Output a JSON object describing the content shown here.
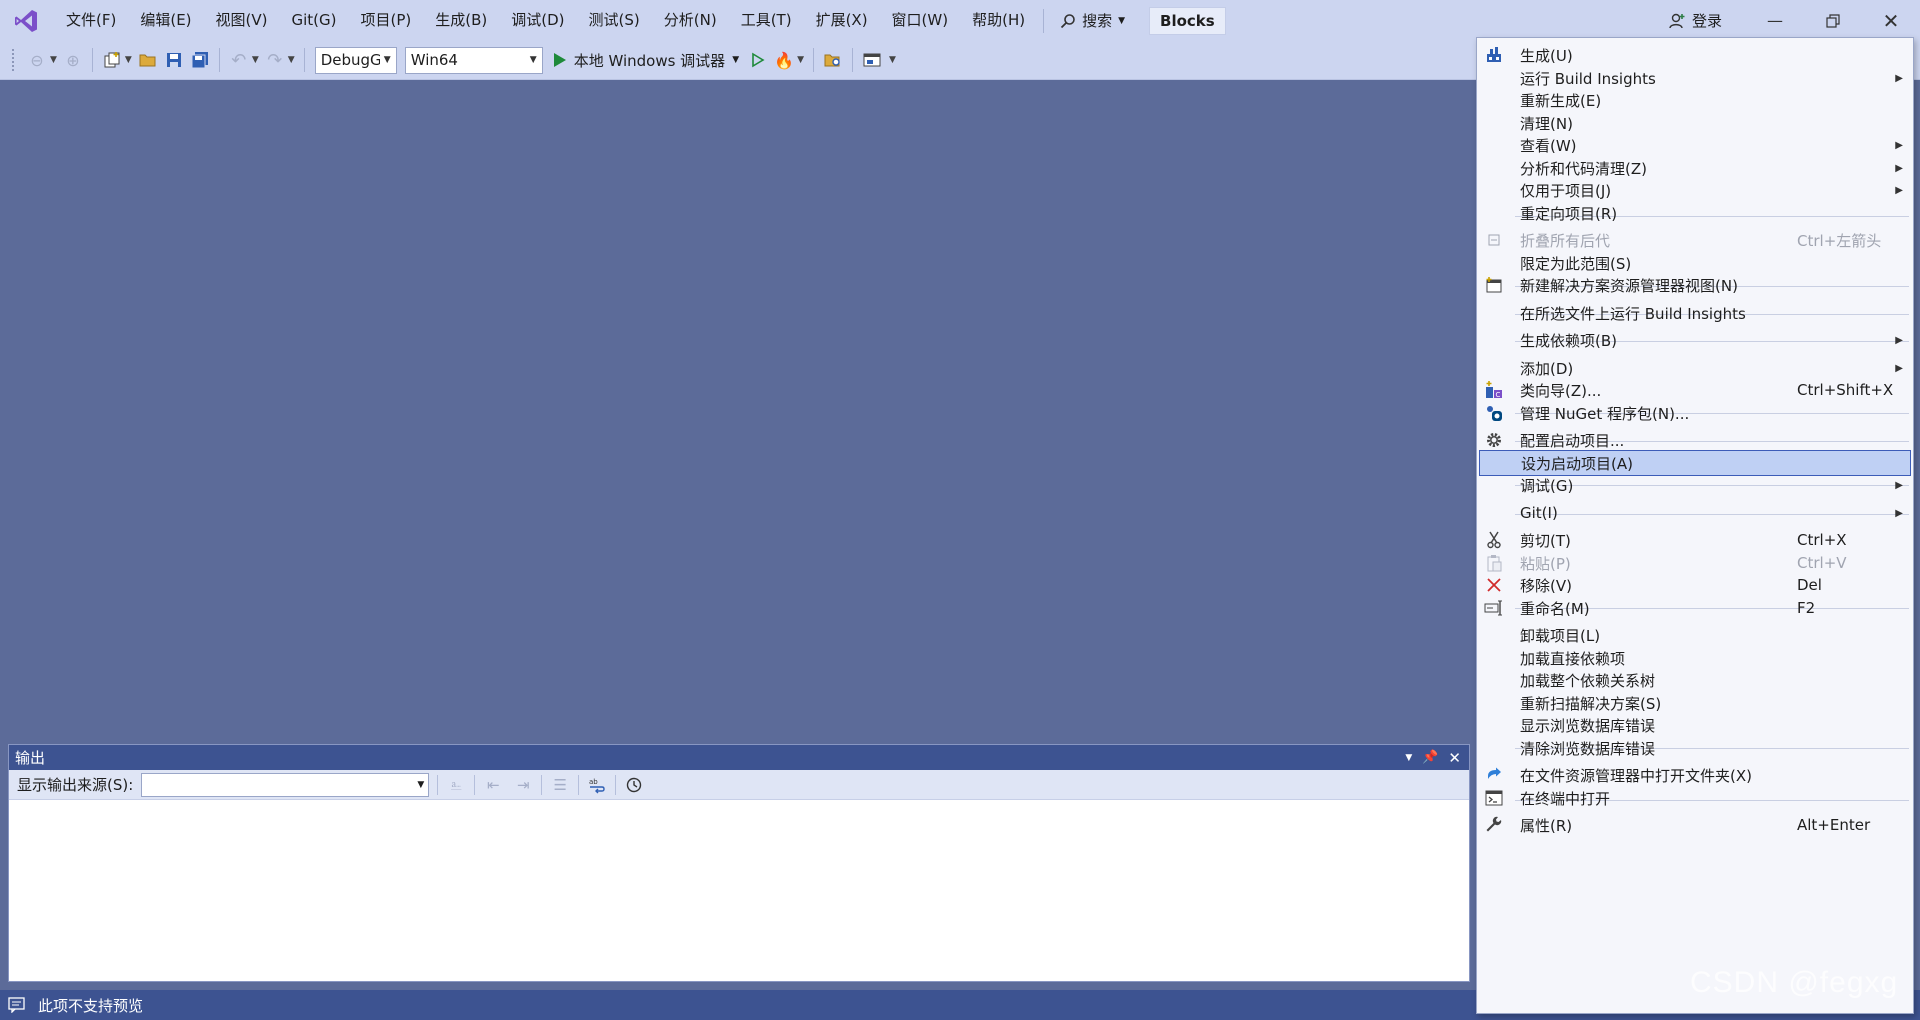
{
  "menubar": {
    "items": [
      "文件(F)",
      "编辑(E)",
      "视图(V)",
      "Git(G)",
      "项目(P)",
      "生成(B)",
      "调试(D)",
      "测试(S)",
      "分析(N)",
      "工具(T)",
      "扩展(X)",
      "窗口(W)",
      "帮助(H)"
    ],
    "search_label": "搜索",
    "solution_name": "Blocks",
    "login_label": "登录"
  },
  "toolbar": {
    "config": "DebugG",
    "platform": "Win64",
    "run_label": "本地 Windows 调试器"
  },
  "output": {
    "title": "输出",
    "source_label": "显示输出来源(S):",
    "source_value": ""
  },
  "statusbar": {
    "text": "此项不支持预览"
  },
  "context_menu": {
    "items": [
      {
        "label": "生成(U)",
        "shortcut": "",
        "submenu": false,
        "disabled": false,
        "icon": "build-icon"
      },
      {
        "label": "运行 Build Insights",
        "shortcut": "",
        "submenu": true,
        "disabled": false,
        "icon": ""
      },
      {
        "label": "重新生成(E)",
        "shortcut": "",
        "submenu": false,
        "disabled": false,
        "icon": ""
      },
      {
        "label": "清理(N)",
        "shortcut": "",
        "submenu": false,
        "disabled": false,
        "icon": ""
      },
      {
        "label": "查看(W)",
        "shortcut": "",
        "submenu": true,
        "disabled": false,
        "icon": ""
      },
      {
        "label": "分析和代码清理(Z)",
        "shortcut": "",
        "submenu": true,
        "disabled": false,
        "icon": ""
      },
      {
        "label": "仅用于项目(J)",
        "shortcut": "",
        "submenu": true,
        "disabled": false,
        "icon": ""
      },
      {
        "label": "重定向项目(R)",
        "shortcut": "",
        "submenu": false,
        "disabled": false,
        "icon": ""
      },
      {
        "label": "折叠所有后代",
        "shortcut": "Ctrl+左箭头",
        "submenu": false,
        "disabled": true,
        "icon": "collapse-icon"
      },
      {
        "label": "限定为此范围(S)",
        "shortcut": "",
        "submenu": false,
        "disabled": false,
        "icon": ""
      },
      {
        "label": "新建解决方案资源管理器视图(N)",
        "shortcut": "",
        "submenu": false,
        "disabled": false,
        "icon": "new-view-icon"
      },
      {
        "label": "在所选文件上运行 Build Insights",
        "shortcut": "",
        "submenu": false,
        "disabled": false,
        "icon": ""
      },
      {
        "label": "生成依赖项(B)",
        "shortcut": "",
        "submenu": true,
        "disabled": false,
        "icon": ""
      },
      {
        "label": "添加(D)",
        "shortcut": "",
        "submenu": true,
        "disabled": false,
        "icon": ""
      },
      {
        "label": "类向导(Z)...",
        "shortcut": "Ctrl+Shift+X",
        "submenu": false,
        "disabled": false,
        "icon": "class-wizard-icon"
      },
      {
        "label": "管理 NuGet 程序包(N)...",
        "shortcut": "",
        "submenu": false,
        "disabled": false,
        "icon": "nuget-icon"
      },
      {
        "label": "配置启动项目...",
        "shortcut": "",
        "submenu": false,
        "disabled": false,
        "icon": "gear-icon"
      },
      {
        "label": "设为启动项目(A)",
        "shortcut": "",
        "submenu": false,
        "disabled": false,
        "icon": ""
      },
      {
        "label": "调试(G)",
        "shortcut": "",
        "submenu": true,
        "disabled": false,
        "icon": ""
      },
      {
        "label": "Git(I)",
        "shortcut": "",
        "submenu": true,
        "disabled": false,
        "icon": ""
      },
      {
        "label": "剪切(T)",
        "shortcut": "Ctrl+X",
        "submenu": false,
        "disabled": false,
        "icon": "cut-icon"
      },
      {
        "label": "粘贴(P)",
        "shortcut": "Ctrl+V",
        "submenu": false,
        "disabled": true,
        "icon": "paste-icon"
      },
      {
        "label": "移除(V)",
        "shortcut": "Del",
        "submenu": false,
        "disabled": false,
        "icon": "remove-icon"
      },
      {
        "label": "重命名(M)",
        "shortcut": "F2",
        "submenu": false,
        "disabled": false,
        "icon": "rename-icon"
      },
      {
        "label": "卸载项目(L)",
        "shortcut": "",
        "submenu": false,
        "disabled": false,
        "icon": ""
      },
      {
        "label": "加载直接依赖项",
        "shortcut": "",
        "submenu": false,
        "disabled": false,
        "icon": ""
      },
      {
        "label": "加载整个依赖关系树",
        "shortcut": "",
        "submenu": false,
        "disabled": false,
        "icon": ""
      },
      {
        "label": "重新扫描解决方案(S)",
        "shortcut": "",
        "submenu": false,
        "disabled": false,
        "icon": ""
      },
      {
        "label": "显示浏览数据库错误",
        "shortcut": "",
        "submenu": false,
        "disabled": false,
        "icon": ""
      },
      {
        "label": "清除浏览数据库错误",
        "shortcut": "",
        "submenu": false,
        "disabled": false,
        "icon": ""
      },
      {
        "label": "在文件资源管理器中打开文件夹(X)",
        "shortcut": "",
        "submenu": false,
        "disabled": false,
        "icon": "open-folder-icon"
      },
      {
        "label": "在终端中打开",
        "shortcut": "",
        "submenu": false,
        "disabled": false,
        "icon": "terminal-icon"
      },
      {
        "label": "属性(R)",
        "shortcut": "Alt+Enter",
        "submenu": false,
        "disabled": false,
        "icon": "wrench-icon"
      }
    ]
  },
  "watermark": "CSDN @fegxg",
  "colors": {
    "menubar_bg": "#ccd5f0",
    "workspace_bg": "#5c6b99",
    "panel_header": "#3d5391",
    "highlight": "#bfd0f4",
    "vs_purple": "#7b4fc9"
  }
}
